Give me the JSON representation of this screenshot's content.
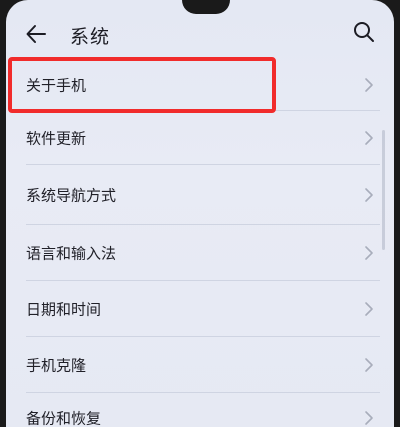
{
  "header": {
    "title": "系统",
    "back_icon": "arrow-left-icon",
    "search_icon": "search-icon"
  },
  "menu": {
    "items": [
      {
        "label": "关于手机"
      },
      {
        "label": "软件更新"
      },
      {
        "label": "系统导航方式"
      },
      {
        "label": "语言和输入法"
      },
      {
        "label": "日期和时间"
      },
      {
        "label": "手机克隆"
      },
      {
        "label": "备份和恢复"
      }
    ]
  },
  "colors": {
    "background": "#e6e9f3",
    "text": "#202028",
    "highlight_border": "#f12b2b",
    "chevron": "#a8adbb"
  }
}
